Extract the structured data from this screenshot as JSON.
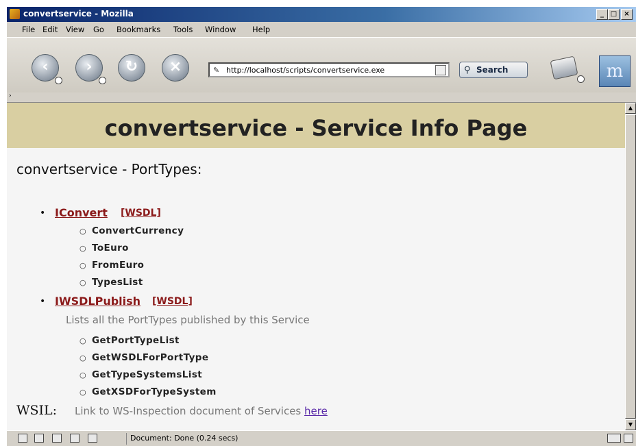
{
  "window": {
    "title": "convertservice - Mozilla",
    "controls": [
      "_",
      "□",
      "×"
    ]
  },
  "menu": [
    "File",
    "Edit",
    "View",
    "Go",
    "Bookmarks",
    "Tools",
    "Window",
    "Help"
  ],
  "toolbar": {
    "url": "http://localhost/scripts/convertservice.exe",
    "search_label": "Search"
  },
  "page": {
    "title": "convertservice - Service Info Page",
    "porttypes_heading": "convertservice - PortTypes:",
    "porttypes": [
      {
        "name": "IConvert",
        "wsdl": "[WSDL]",
        "description": "",
        "operations": [
          "ConvertCurrency",
          "ToEuro",
          "FromEuro",
          "TypesList"
        ]
      },
      {
        "name": "IWSDLPublish",
        "wsdl": "[WSDL]",
        "description": "Lists all the PortTypes published by this Service",
        "operations": [
          "GetPortTypeList",
          "GetWSDLForPortType",
          "GetTypeSystemsList",
          "GetXSDForTypeSystem"
        ]
      }
    ],
    "wsil_label": "WSIL:",
    "wsil_text": "Link to WS-Inspection document of Services",
    "wsil_link": "here"
  },
  "status": {
    "text": "Document: Done (0.24 secs)"
  },
  "colors": {
    "banner": "#d9cfa2",
    "link": "#8b1a1a",
    "visited_link": "#5a2aa8"
  }
}
